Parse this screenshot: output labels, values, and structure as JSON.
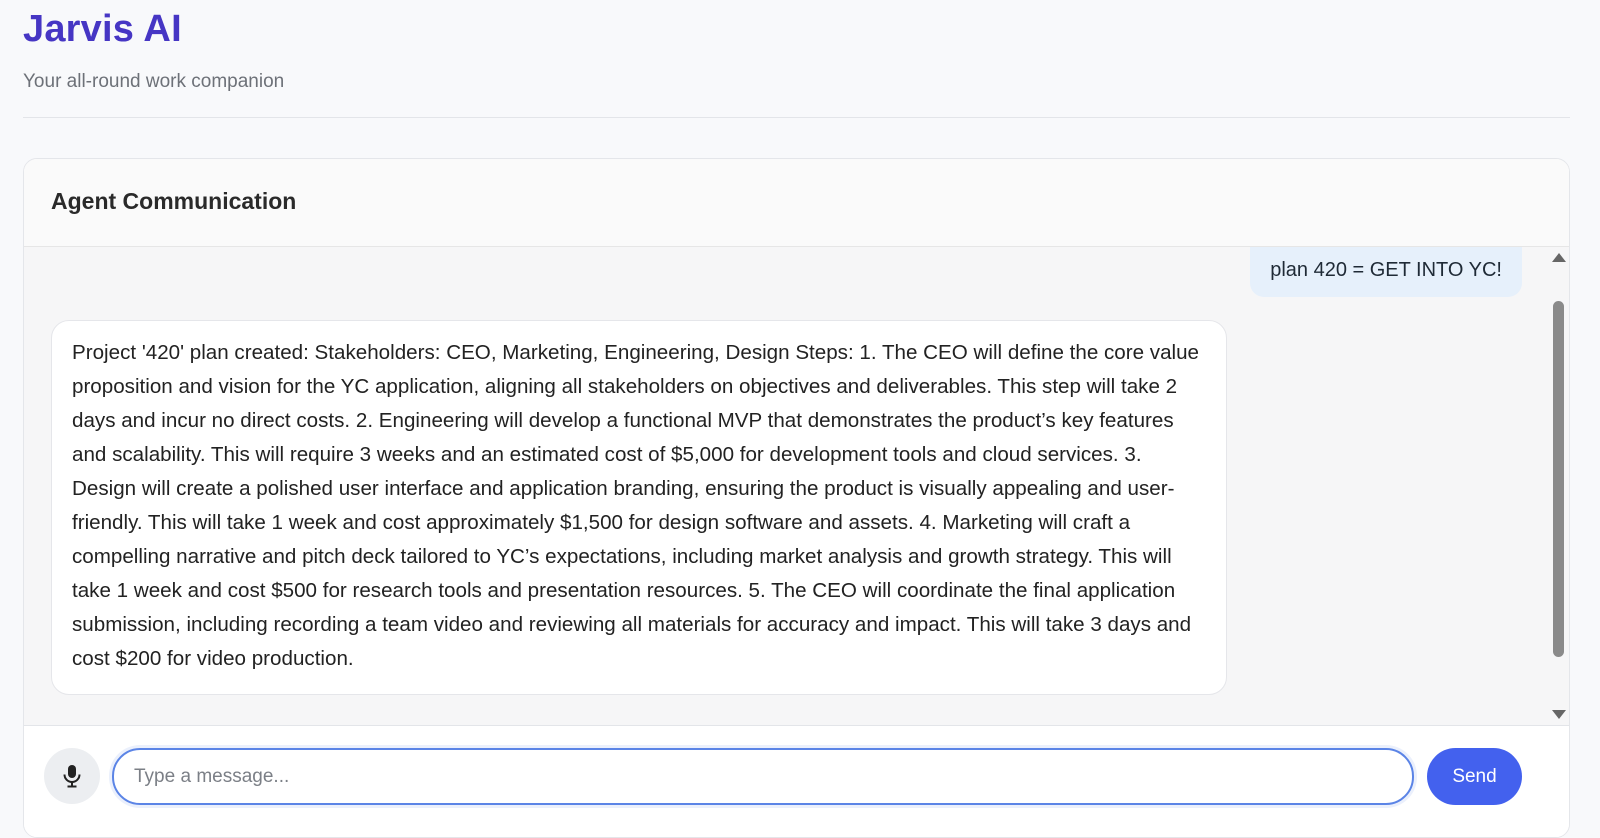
{
  "header": {
    "title": "Jarvis AI",
    "subtitle": "Your all-round work companion"
  },
  "panel": {
    "title": "Agent Communication"
  },
  "messages": [
    {
      "role": "user",
      "text": "plan 420 = GET INTO YC!"
    },
    {
      "role": "agent",
      "text": "Project '420' plan created: Stakeholders: CEO, Marketing, Engineering, Design Steps: 1. The CEO will define the core value proposition and vision for the YC application, aligning all stakeholders on objectives and deliverables. This step will take 2 days and incur no direct costs. 2. Engineering will develop a functional MVP that demonstrates the product’s key features and scalability. This will require 3 weeks and an estimated cost of $5,000 for development tools and cloud services. 3. Design will create a polished user interface and application branding, ensuring the product is visually appealing and user-friendly. This will take 1 week and cost approximately $1,500 for design software and assets. 4. Marketing will craft a compelling narrative and pitch deck tailored to YC’s expectations, including market analysis and growth strategy. This will take 1 week and cost $500 for research tools and presentation resources. 5. The CEO will coordinate the final application submission, including recording a team video and reviewing all materials for accuracy and impact. This will take 3 days and cost $200 for video production."
    }
  ],
  "composer": {
    "mic_icon": "microphone-icon",
    "input_value": "",
    "input_placeholder": "Type a message...",
    "send_label": "Send"
  },
  "colors": {
    "brand": "#4636c4",
    "accent": "#4361ee",
    "user_bubble": "#e6f0fb"
  }
}
